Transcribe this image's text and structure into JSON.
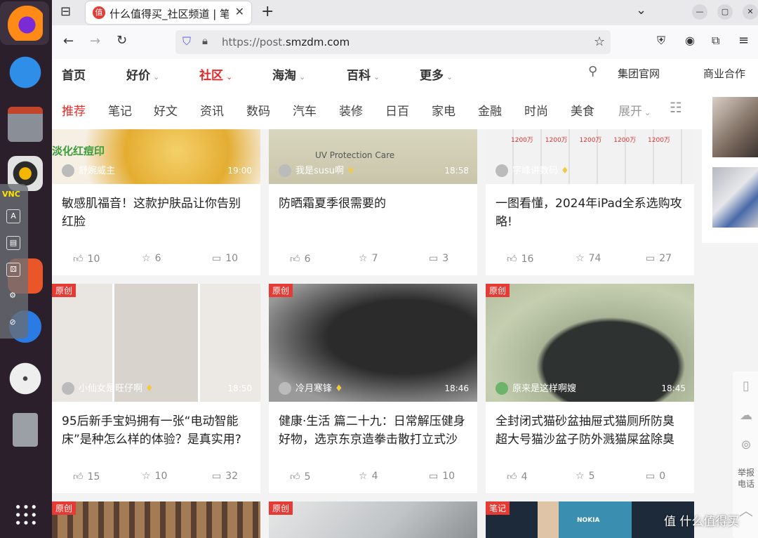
{
  "browser": {
    "tab_title": "什么值得买_社区频道 | 笔",
    "favicon_text": "值",
    "url_prefix": "https://post.",
    "url_domain": "smzdm.com"
  },
  "dock": {
    "vnc_label": "VNC",
    "apps": [
      "firefox-icon",
      "thunderbird-icon",
      "files-icon",
      "rhythmbox-icon",
      "writer-icon",
      "appcenter-icon",
      "help-icon",
      "dvd-icon",
      "trash-icon",
      "app-grid-icon"
    ]
  },
  "main_nav": {
    "items": [
      {
        "label": "首页",
        "chev": ""
      },
      {
        "label": "好价",
        "chev": "⌄"
      },
      {
        "label": "社区",
        "chev": "⌄"
      },
      {
        "label": "海淘",
        "chev": "⌄"
      },
      {
        "label": "百科",
        "chev": "⌄"
      },
      {
        "label": "更多",
        "chev": "⌄"
      }
    ],
    "group_site": "集团官网",
    "business": "商业合作"
  },
  "categories": [
    "推荐",
    "笔记",
    "好文",
    "资讯",
    "数码",
    "汽车",
    "装修",
    "日百",
    "家电",
    "金融",
    "时尚",
    "美食"
  ],
  "expand_label": "展开",
  "cards": [
    {
      "author": "舒婉威主",
      "time": "19:00",
      "title": "敏感肌福音！这款护肤品让你告别红脸",
      "likes": "10",
      "favs": "6",
      "comments": "10",
      "badge": "",
      "img_text": "淡化红痘印"
    },
    {
      "author": "我是susu啊",
      "time": "18:58",
      "title": "防晒霜夏季很需要的",
      "likes": "6",
      "favs": "7",
      "comments": "3",
      "badge": "",
      "img_text": "UV Protection Care"
    },
    {
      "author": "字峰讲数码",
      "time": "",
      "title": "一图看懂，2024年iPad全系选购攻略!",
      "likes": "16",
      "favs": "74",
      "comments": "27",
      "badge": "",
      "img_text": "1200万 1200万 1200万 1200万 1200万"
    },
    {
      "author": "小仙女是旺仔啊",
      "time": "18:50",
      "title": "95后新手宝妈拥有一张“电动智能床”是种怎么样的体验？是真实用?",
      "likes": "15",
      "favs": "10",
      "comments": "32",
      "badge": "原创",
      "img_text": ""
    },
    {
      "author": "冷月寒锋",
      "time": "18:46",
      "title": "健康·生活 篇二十九：日常解压健身好物，选京东京造拳击散打立式沙",
      "likes": "5",
      "favs": "4",
      "comments": "10",
      "badge": "原创",
      "img_text": ""
    },
    {
      "author": "原来是这样啊嫂",
      "time": "18:45",
      "title": "全封闭式猫砂盆抽屉式猫厕所防臭超大号猫沙盆子防外溅猫屎盆除臭",
      "likes": "4",
      "favs": "5",
      "comments": "0",
      "badge": "原创",
      "img_text": ""
    },
    {
      "badge": "原创"
    },
    {
      "badge": "原创"
    },
    {
      "badge": "笔记",
      "img_text": "NOKIA"
    }
  ],
  "side_tools": {
    "report": "举报电话"
  },
  "watermark": "值 什么值得买"
}
